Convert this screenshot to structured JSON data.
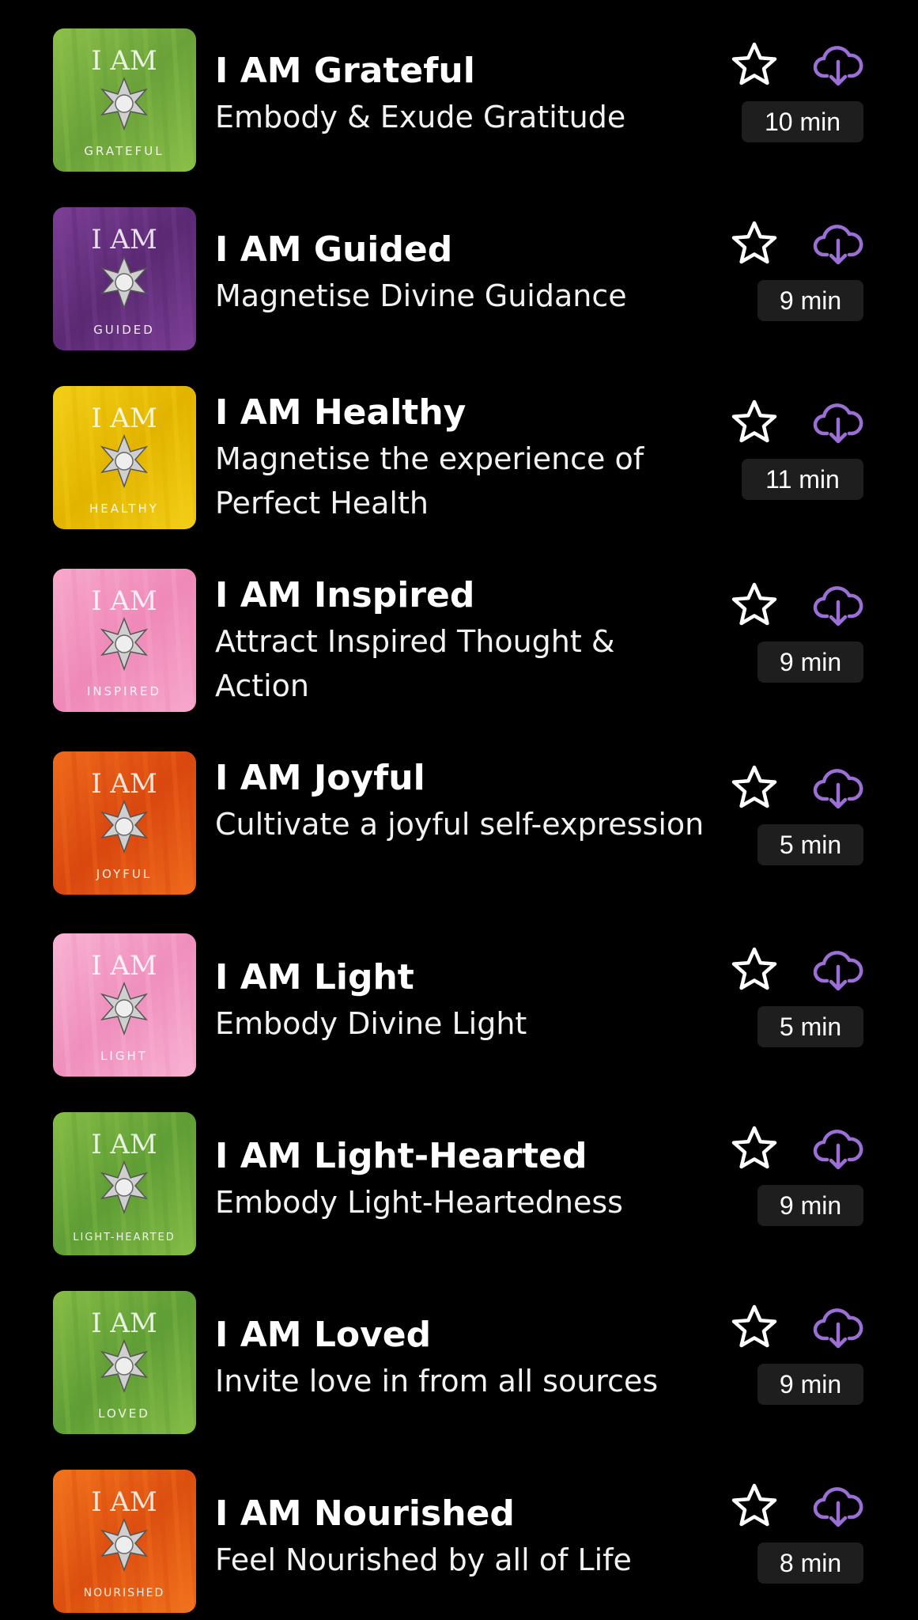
{
  "meditations": [
    {
      "title": "I AM Grateful",
      "subtitle": "Embody & Exude Gratitude",
      "duration": "10 min",
      "art_top": "I AM",
      "art_bottom": "GRATEFUL",
      "art_color": "#6aa23a",
      "art_color_2": "#8cc04a",
      "favorite_icon": "star-outline-icon",
      "download_icon": "cloud-download-icon"
    },
    {
      "title": "I AM Guided",
      "subtitle": "Magnetise Divine Guidance",
      "duration": "9 min",
      "art_top": "I AM",
      "art_bottom": "GUIDED",
      "art_color": "#5b2a73",
      "art_color_2": "#7d3f97",
      "favorite_icon": "star-outline-icon",
      "download_icon": "cloud-download-icon"
    },
    {
      "title": "I AM Healthy",
      "subtitle": "Magnetise the experience of Perfect Health",
      "duration": "11 min",
      "art_top": "I AM",
      "art_bottom": "HEALTHY",
      "art_color": "#e2b400",
      "art_color_2": "#f3cf19",
      "favorite_icon": "star-outline-icon",
      "download_icon": "cloud-download-icon"
    },
    {
      "title": "I AM Inspired",
      "subtitle": "Attract Inspired Thought & Action",
      "duration": "9 min",
      "art_top": "I AM",
      "art_bottom": "INSPIRED",
      "art_color": "#ef89b8",
      "art_color_2": "#f7a9cb",
      "favorite_icon": "star-outline-icon",
      "download_icon": "cloud-download-icon"
    },
    {
      "title": "I AM Joyful",
      "subtitle": "Cultivate a joyful self-expression",
      "duration": "5 min",
      "art_top": "I AM",
      "art_bottom": "JOYFUL",
      "art_color": "#d9480f",
      "art_color_2": "#f06a1c",
      "favorite_icon": "star-outline-icon",
      "download_icon": "cloud-download-icon"
    },
    {
      "title": "I AM Light",
      "subtitle": "Embody Divine Light",
      "duration": "5 min",
      "art_top": "I AM",
      "art_bottom": "LIGHT",
      "art_color": "#ef8fbd",
      "art_color_2": "#f8b3d2",
      "favorite_icon": "star-outline-icon",
      "download_icon": "cloud-download-icon"
    },
    {
      "title": "I AM Light-Hearted",
      "subtitle": "Embody Light-Heartedness",
      "duration": "9 min",
      "art_top": "I AM",
      "art_bottom": "LIGHT-HEARTED",
      "art_color": "#5f9d36",
      "art_color_2": "#86bd47",
      "favorite_icon": "star-outline-icon",
      "download_icon": "cloud-download-icon"
    },
    {
      "title": "I AM Loved",
      "subtitle": "Invite love in from all sources",
      "duration": "9 min",
      "art_top": "I AM",
      "art_bottom": "LOVED",
      "art_color": "#5f9d36",
      "art_color_2": "#86bd47",
      "favorite_icon": "star-outline-icon",
      "download_icon": "cloud-download-icon"
    },
    {
      "title": "I AM Nourished",
      "subtitle": "Feel Nourished by all of Life",
      "duration": "8 min",
      "art_top": "I AM",
      "art_bottom": "NOURISHED",
      "art_color": "#dc4f10",
      "art_color_2": "#f2741e",
      "favorite_icon": "star-outline-icon",
      "download_icon": "cloud-download-icon"
    }
  ],
  "colors": {
    "background": "#000000",
    "title": "#ffffff",
    "subtitle": "#f2f2f2",
    "star": "#ffffff",
    "download": "#9b6fd6",
    "duration_bg": "#1e1e1e"
  }
}
